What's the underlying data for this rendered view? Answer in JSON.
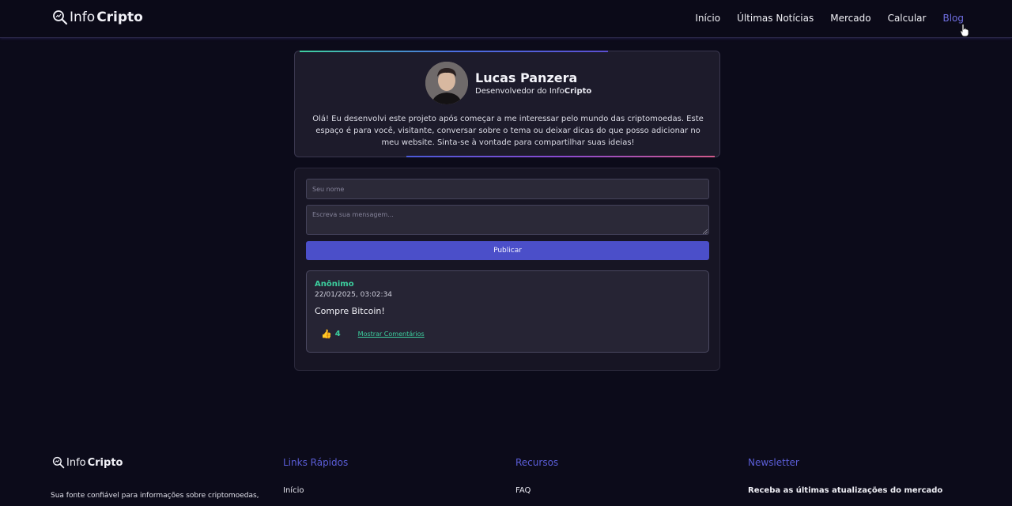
{
  "header": {
    "logo_info": "Info",
    "logo_cripto": "Cripto",
    "nav": [
      {
        "label": "Início"
      },
      {
        "label": "Últimas Notícias"
      },
      {
        "label": "Mercado"
      },
      {
        "label": "Calcular"
      },
      {
        "label": "Blog",
        "active": true
      }
    ]
  },
  "profile": {
    "name": "Lucas Panzera",
    "role_prefix": "Desenvolvedor do Info",
    "role_brand": "Cripto",
    "bio": "Olá! Eu desenvolvi este projeto após começar a me interessar pelo mundo das criptomoedas. Este espaço é para você, visitante, conversar sobre o tema ou deixar dicas do que posso adicionar no meu website. Sinta-se à vontade para compartilhar suas ideias!"
  },
  "form": {
    "name_placeholder": "Seu nome",
    "name_value": "",
    "message_placeholder": "Escreva sua mensagem...",
    "message_value": "",
    "publish_label": "Publicar"
  },
  "posts": [
    {
      "author": "Anônimo",
      "timestamp": "22/01/2025, 03:02:34",
      "content": "Compre Bitcoin!",
      "likes": "4",
      "show_comments_label": "Mostrar Comentários",
      "like_icon": "thumbs-up-icon"
    }
  ],
  "footer": {
    "logo_info": "Info",
    "logo_cripto": "Cripto",
    "tagline": "Sua fonte confiável para informações sobre criptomoedas,",
    "columns": [
      {
        "title": "Links Rápidos",
        "first": "Início"
      },
      {
        "title": "Recursos",
        "first": "FAQ"
      },
      {
        "title": "Newsletter",
        "first": "Receba as últimas atualizações do mercado"
      }
    ]
  },
  "colors": {
    "accent": "#5b5ed8",
    "green": "#3ccf9e",
    "button": "#4b4fc9",
    "background": "#0c0b1a"
  }
}
